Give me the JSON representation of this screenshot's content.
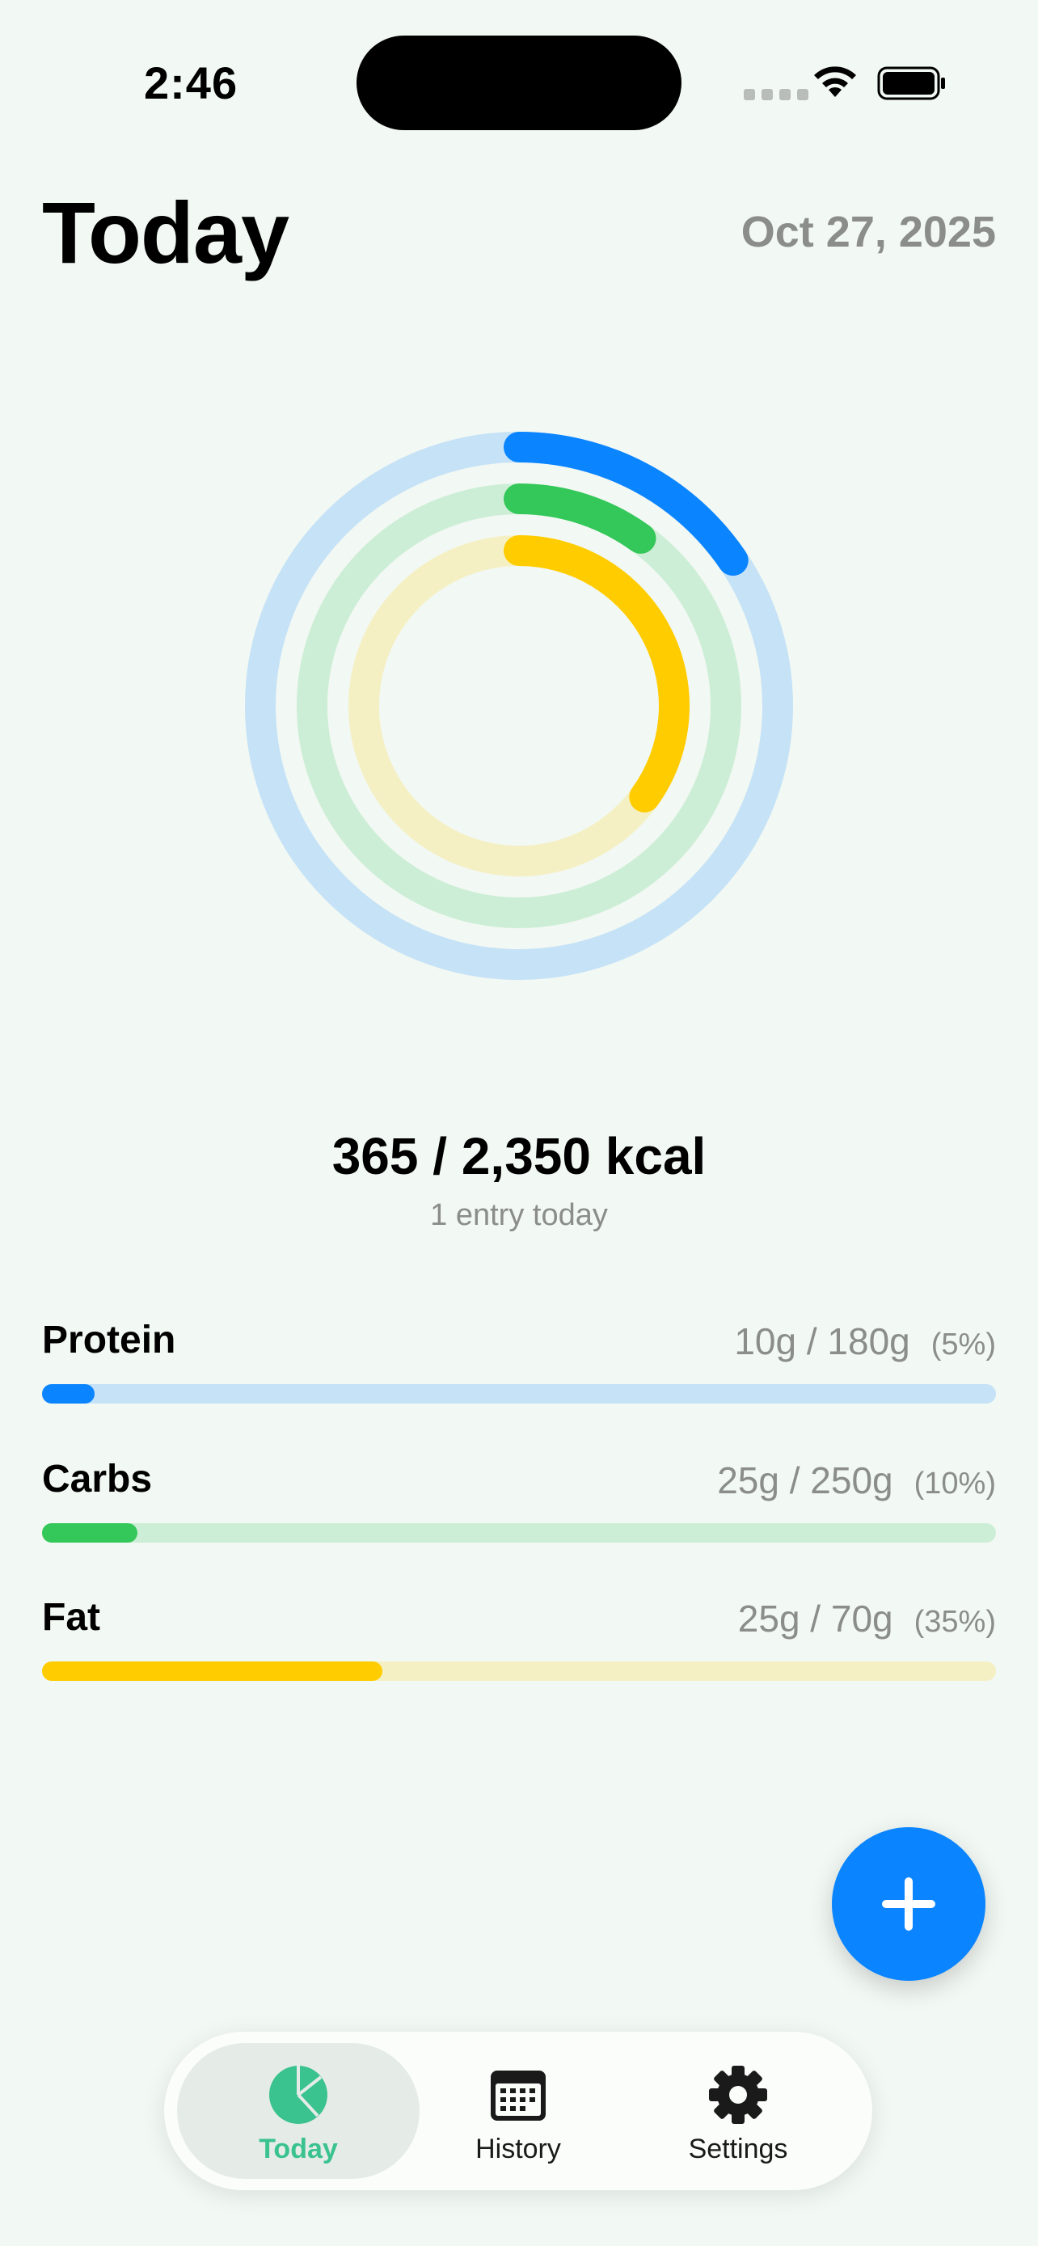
{
  "status_bar": {
    "time": "2:46"
  },
  "header": {
    "title": "Today",
    "date": "Oct 27, 2025"
  },
  "rings": {
    "calories": {
      "color": "#0a84ff",
      "track_color": "#c5e2f7",
      "progress": 0.155
    },
    "carbs": {
      "color": "#34c759",
      "track_color": "#cdeed6",
      "progress": 0.1
    },
    "fat": {
      "color": "#ffcc00",
      "track_color": "#f5f0c4",
      "progress": 0.35
    }
  },
  "summary": {
    "kcal": "365 / 2,350 kcal",
    "entries": "1 entry today"
  },
  "macros": [
    {
      "name": "Protein",
      "values": "10g / 180g",
      "percent_label": "(5%)",
      "progress": 0.055,
      "color": "#0a84ff",
      "track_color": "#c5e2f7"
    },
    {
      "name": "Carbs",
      "values": "25g / 250g",
      "percent_label": "(10%)",
      "progress": 0.1,
      "color": "#34c759",
      "track_color": "#cdeed6"
    },
    {
      "name": "Fat",
      "values": "25g / 70g",
      "percent_label": "(35%)",
      "progress": 0.357,
      "color": "#ffcc00",
      "track_color": "#f5f0c4"
    }
  ],
  "fab": {
    "icon": "plus-icon",
    "color": "#0a84ff"
  },
  "tab_bar": {
    "tabs": [
      {
        "label": "Today",
        "icon": "pie-chart-icon",
        "active": true
      },
      {
        "label": "History",
        "icon": "calendar-icon",
        "active": false
      },
      {
        "label": "Settings",
        "icon": "gear-icon",
        "active": false
      }
    ],
    "active_color": "#3ac28f"
  }
}
